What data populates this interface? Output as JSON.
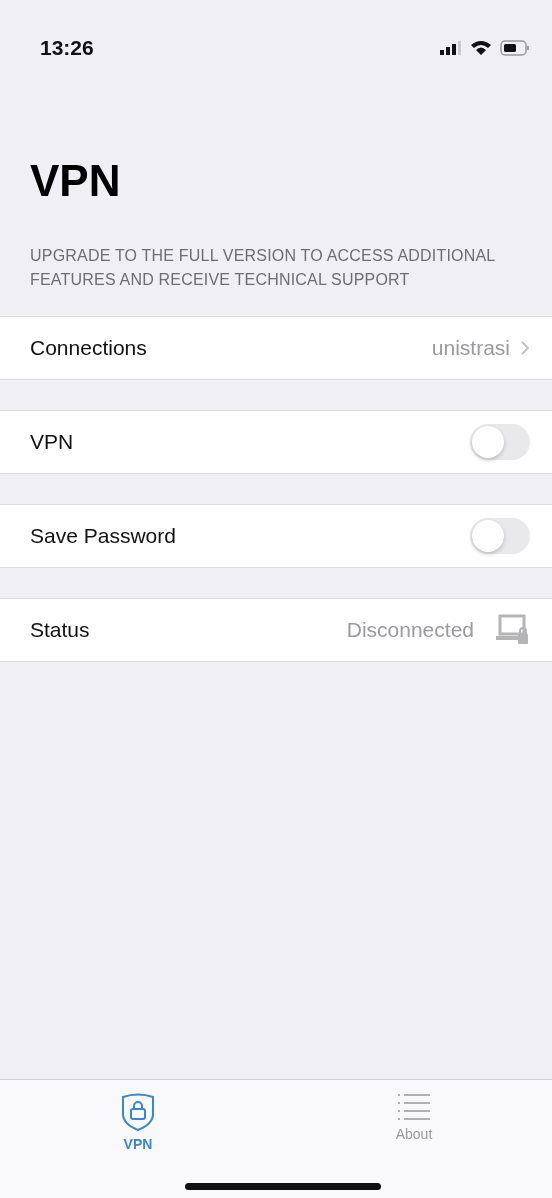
{
  "status_bar": {
    "time": "13:26"
  },
  "title": "VPN",
  "notice": "UPGRADE TO THE FULL VERSION TO ACCESS ADDITIONAL FEATURES AND RECEIVE TECHNICAL SUPPORT",
  "rows": [
    {
      "kind": "link",
      "label": "Connections",
      "value": "unistrasi"
    },
    {
      "kind": "toggle",
      "label": "VPN",
      "on": false
    },
    {
      "kind": "toggle",
      "label": "Save Password",
      "on": false
    },
    {
      "kind": "status",
      "label": "Status",
      "value": "Disconnected"
    }
  ],
  "tabs": [
    {
      "kind": "shield",
      "label": "VPN",
      "selected": true
    },
    {
      "kind": "list",
      "label": "About",
      "selected": false
    }
  ]
}
